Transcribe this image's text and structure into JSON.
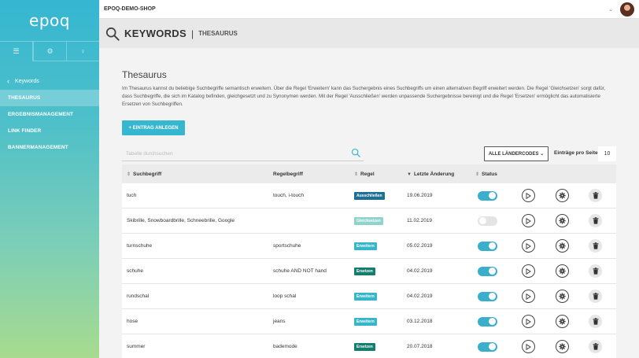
{
  "sidebar": {
    "logo": "epoq",
    "tabs": [
      {
        "icon": "menu-icon",
        "glyph": "☰"
      },
      {
        "icon": "gear-icon",
        "glyph": "⚙"
      },
      {
        "icon": "lightbulb-icon",
        "glyph": "♀"
      }
    ],
    "back_label": "Keywords",
    "items": [
      {
        "label": "THESAURUS",
        "active": true
      },
      {
        "label": "ERGEBNISMANAGEMENT",
        "active": false
      },
      {
        "label": "LINK FINDER",
        "active": false
      },
      {
        "label": "BANNERMANAGEMENT",
        "active": false
      }
    ]
  },
  "topbar": {
    "shop_name": "EPOQ-DEMO-SHOP",
    "dropdown_glyph": "⌄"
  },
  "page_header": {
    "title": "KEYWORDS",
    "subtitle": "THESAURUS"
  },
  "main": {
    "heading": "Thesaurus",
    "description": "Im Thesaurus kannst du beliebige Suchbegriffe semantisch erweitern. Über die Regel 'Erweitern' kann das Suchergebnis eines Suchbegriffs um einen alternativen Begriff erweitert werden. Die Regel 'Gleichsetzen' sorgt dafür, dass Suchbegriffe, die sich im Katalog befinden, gleichgesetzt und zu Synonymen werden. Mit der Regel 'Ausschließen' werden unpassende Suchergebnisse bereinigt und die Regel 'Ersetzen' ermöglicht das automatisierte Ersetzen von Suchbegriffen.",
    "add_button": "+ EINTRAG ANLEGEN",
    "search_placeholder": "Tabelle durchsuchen",
    "countries_button": "ALLE LÄNDERCODES ⌄",
    "per_page_label": "Einträge pro Seite",
    "per_page_value": "10"
  },
  "table": {
    "headers": {
      "term": "Suchbegriff",
      "rule_term": "Regelbegriff",
      "rule": "Regel",
      "changed": "Letzte Änderung",
      "status": "Status"
    },
    "rows": [
      {
        "term": "tuch",
        "rule_term": "touch, i-touch",
        "rule": "Ausschließen",
        "rule_color": "#1f6f92",
        "changed": "19.06.2019",
        "status": true
      },
      {
        "term": "Skibrille, Snowboardbrille, Schneebrille, Google",
        "rule_term": "",
        "rule": "Gleichsetzen",
        "rule_color": "#8fd4cc",
        "changed": "11.02.2019",
        "status": false
      },
      {
        "term": "turnschuhe",
        "rule_term": "sportschuhe",
        "rule": "Erweitern",
        "rule_color": "#35b6c9",
        "changed": "05.02.2019",
        "status": true
      },
      {
        "term": "schuhe",
        "rule_term": "schuhe AND NOT hand",
        "rule": "Ersetzen",
        "rule_color": "#157d6e",
        "changed": "04.02.2019",
        "status": true
      },
      {
        "term": "rundschal",
        "rule_term": "loop schal",
        "rule": "Erweitern",
        "rule_color": "#35b6c9",
        "changed": "04.02.2019",
        "status": true
      },
      {
        "term": "hose",
        "rule_term": "jeans",
        "rule": "Erweitern",
        "rule_color": "#35b6c9",
        "changed": "03.12.2018",
        "status": true
      },
      {
        "term": "summer",
        "rule_term": "bademode",
        "rule": "Ersetzen",
        "rule_color": "#157d6e",
        "changed": "20.07.2018",
        "status": true
      }
    ]
  },
  "colors": {
    "accent": "#37b7cf",
    "toggle_on": "#3aaecb"
  }
}
